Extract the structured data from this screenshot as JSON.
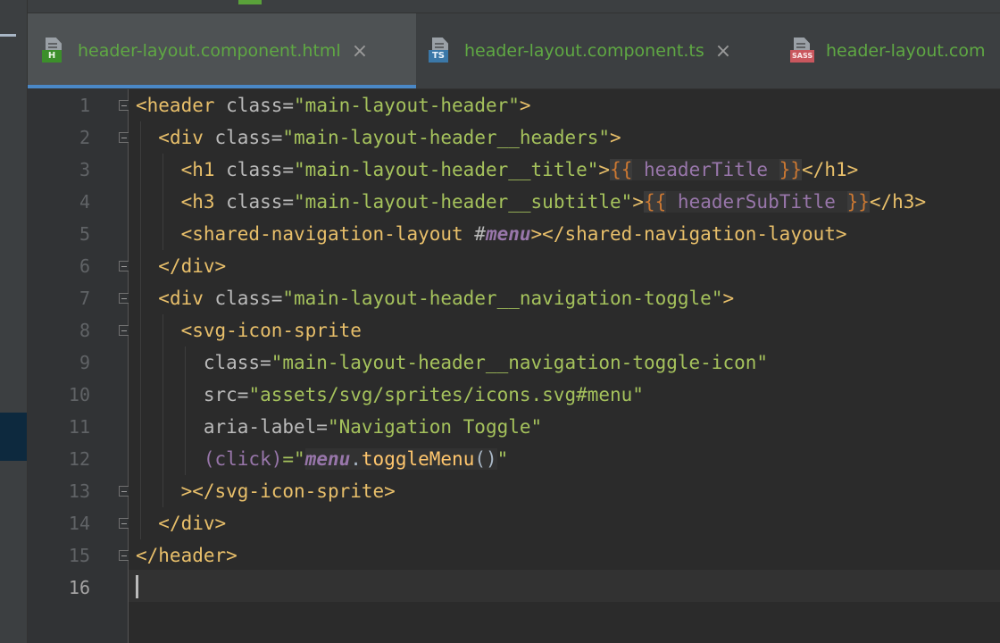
{
  "tabs": [
    {
      "label": "header-layout.component.html",
      "badge": "H",
      "active": true
    },
    {
      "label": "header-layout.component.ts",
      "badge": "TS",
      "active": false
    },
    {
      "label": "header-layout.com",
      "badge": "SASS",
      "active": false
    }
  ],
  "close_glyph": "×",
  "line_numbers": [
    "1",
    "2",
    "3",
    "4",
    "5",
    "6",
    "7",
    "8",
    "9",
    "10",
    "11",
    "12",
    "13",
    "14",
    "15",
    "16"
  ],
  "code": {
    "l1": {
      "open": "<header",
      "attr": " class=",
      "val": "\"main-layout-header\"",
      "close": ">"
    },
    "l2": {
      "indent": "  ",
      "open": "<div",
      "attr": " class=",
      "val": "\"main-layout-header__headers\"",
      "close": ">"
    },
    "l3": {
      "indent": "    ",
      "open": "<h1",
      "attr": " class=",
      "val": "\"main-layout-header__title\"",
      "close": ">",
      "brace_open": "{{",
      "expr": " headerTitle ",
      "brace_close": "}}",
      "end": "</h1>"
    },
    "l4": {
      "indent": "    ",
      "open": "<h3",
      "attr": " class=",
      "val": "\"main-layout-header__subtitle\"",
      "close": ">",
      "brace_open": "{{",
      "expr": " headerSubTitle ",
      "brace_close": "}}",
      "end": "</h3>"
    },
    "l5": {
      "indent": "    ",
      "open": "<shared-navigation-layout",
      "attr": " #",
      "ref": "menu",
      "close": "></shared-navigation-layout>"
    },
    "l6": {
      "indent": "  ",
      "text": "</div>"
    },
    "l7": {
      "indent": "  ",
      "open": "<div",
      "attr": " class=",
      "val": "\"main-layout-header__navigation-toggle\"",
      "close": ">"
    },
    "l8": {
      "indent": "    ",
      "text": "<svg-icon-sprite"
    },
    "l9": {
      "indent": "      ",
      "attr": "class=",
      "val": "\"main-layout-header__navigation-toggle-icon\""
    },
    "l10": {
      "indent": "      ",
      "attr": "src=",
      "val": "\"assets/svg/sprites/icons.svg#menu\""
    },
    "l11": {
      "indent": "      ",
      "attr": "aria-label=",
      "val": "\"Navigation Toggle\""
    },
    "l12": {
      "indent": "      ",
      "evt": "(click)",
      "eq": "=\"",
      "ref": "menu",
      "dot": ".",
      "meth": "toggleMenu",
      "paren": "()",
      "q": "\""
    },
    "l13": {
      "indent": "    ",
      "text": "></svg-icon-sprite>"
    },
    "l14": {
      "indent": "  ",
      "text": "</div>"
    },
    "l15": {
      "text": "</header>"
    },
    "l16": {
      "text": ""
    }
  },
  "colors": {
    "tag": "#e8bf6a",
    "attribute": "#bababa",
    "string": "#a5c25c",
    "interpolation": "#cc7832",
    "variable": "#9876aa",
    "method": "#ffc66d",
    "tab_text": "#5fa843",
    "tab_underline": "#4a88c7"
  }
}
